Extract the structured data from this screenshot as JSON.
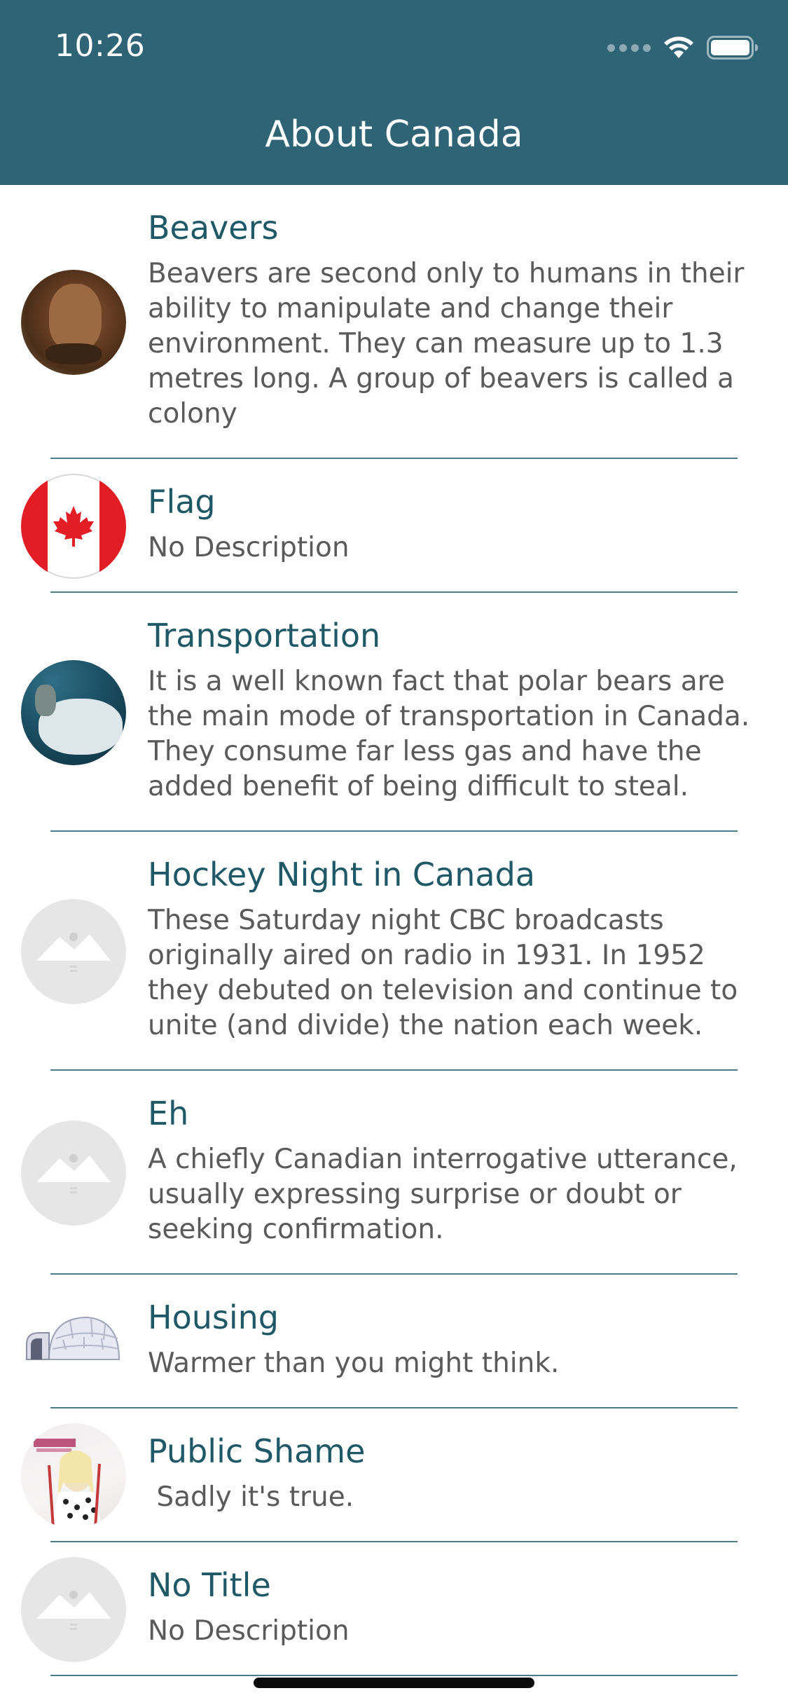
{
  "status_bar": {
    "time": "10:26"
  },
  "nav": {
    "title": "About Canada"
  },
  "colors": {
    "header_bg": "#2e6475",
    "title_text": "#1f5866",
    "desc_text": "#5a5a5a"
  },
  "rows": [
    {
      "title": "Beavers",
      "description": "Beavers are second only to humans in their ability to manipulate and change their environment. They can measure up to 1.3 metres long. A group of beavers is called a colony",
      "icon": "beaver-image"
    },
    {
      "title": "Flag",
      "description": "No Description",
      "icon": "canada-flag-image"
    },
    {
      "title": "Transportation",
      "description": "It is a well known fact that polar bears are the main mode of transportation in Canada. They consume far less gas and have the added benefit of being difficult to steal.",
      "icon": "polar-bear-image"
    },
    {
      "title": "Hockey Night in Canada",
      "description": "These Saturday night CBC broadcasts originally aired on radio in 1931. In 1952 they debuted on television and continue to unite (and divide) the nation each week.",
      "icon": "placeholder-image"
    },
    {
      "title": "Eh",
      "description": "A chiefly Canadian interrogative utterance, usually expressing surprise or doubt or seeking confirmation.",
      "icon": "placeholder-image"
    },
    {
      "title": "Housing",
      "description": "Warmer than you might think.",
      "icon": "igloo-image"
    },
    {
      "title": "Public Shame",
      "description": " Sadly it's true.",
      "icon": "album-cover-image"
    },
    {
      "title": "No Title",
      "description": "No Description",
      "icon": "placeholder-image"
    }
  ]
}
